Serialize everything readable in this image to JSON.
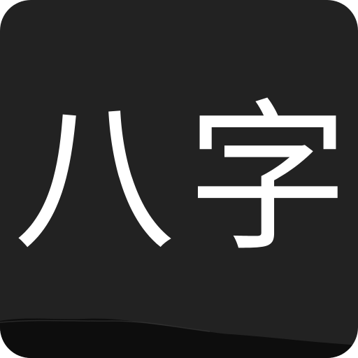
{
  "icon": {
    "glyphs": [
      "八",
      "字"
    ],
    "colors": {
      "background": "#222222",
      "glyph": "#ffffff",
      "ridge": "#0d0d0d"
    }
  }
}
